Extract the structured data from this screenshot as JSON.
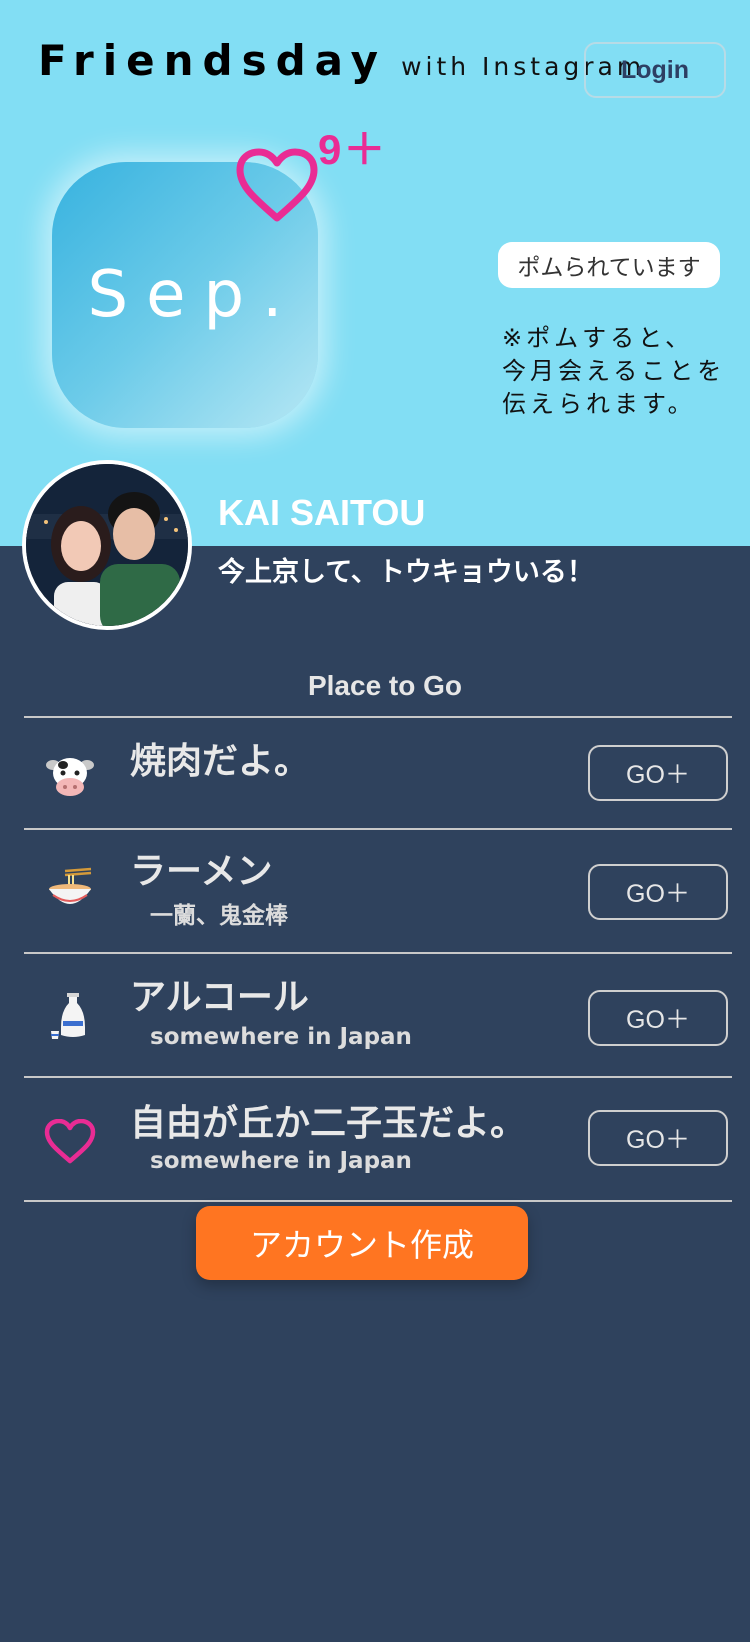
{
  "header": {
    "brand_name": "Friendsday",
    "brand_sub": "with Instagram",
    "login_label": "Login"
  },
  "card": {
    "month": "Sep.",
    "heart_count": "9＋",
    "pom_badge": "ポムられています",
    "pom_note_lines": [
      "※ポムすると、",
      "今月会えることを",
      "伝えられます。"
    ]
  },
  "profile": {
    "name": "KAI SAITOU",
    "status": "今上京して、トウキョウいる！"
  },
  "places": {
    "title": "Place to Go",
    "items": [
      {
        "icon": "cow-face-icon",
        "title": "焼肉だよ。",
        "subtitle": "",
        "button": "GO＋"
      },
      {
        "icon": "ramen-bowl-icon",
        "title": "ラーメン",
        "subtitle": "一蘭、鬼金棒",
        "button": "GO＋"
      },
      {
        "icon": "sake-bottle-icon",
        "title": "アルコール",
        "subtitle": "somewhere in Japan",
        "button": "GO＋"
      },
      {
        "icon": "heart-outline-icon",
        "title": "自由が丘か二子玉だよ。",
        "subtitle": "somewhere in Japan",
        "button": "GO＋"
      }
    ]
  },
  "cta": {
    "create_account_label": "アカウント作成"
  },
  "colors": {
    "top_band": "#82def4",
    "body": "#2f425d",
    "accent_pink": "#e92c94",
    "cta_orange": "#ff7521"
  }
}
